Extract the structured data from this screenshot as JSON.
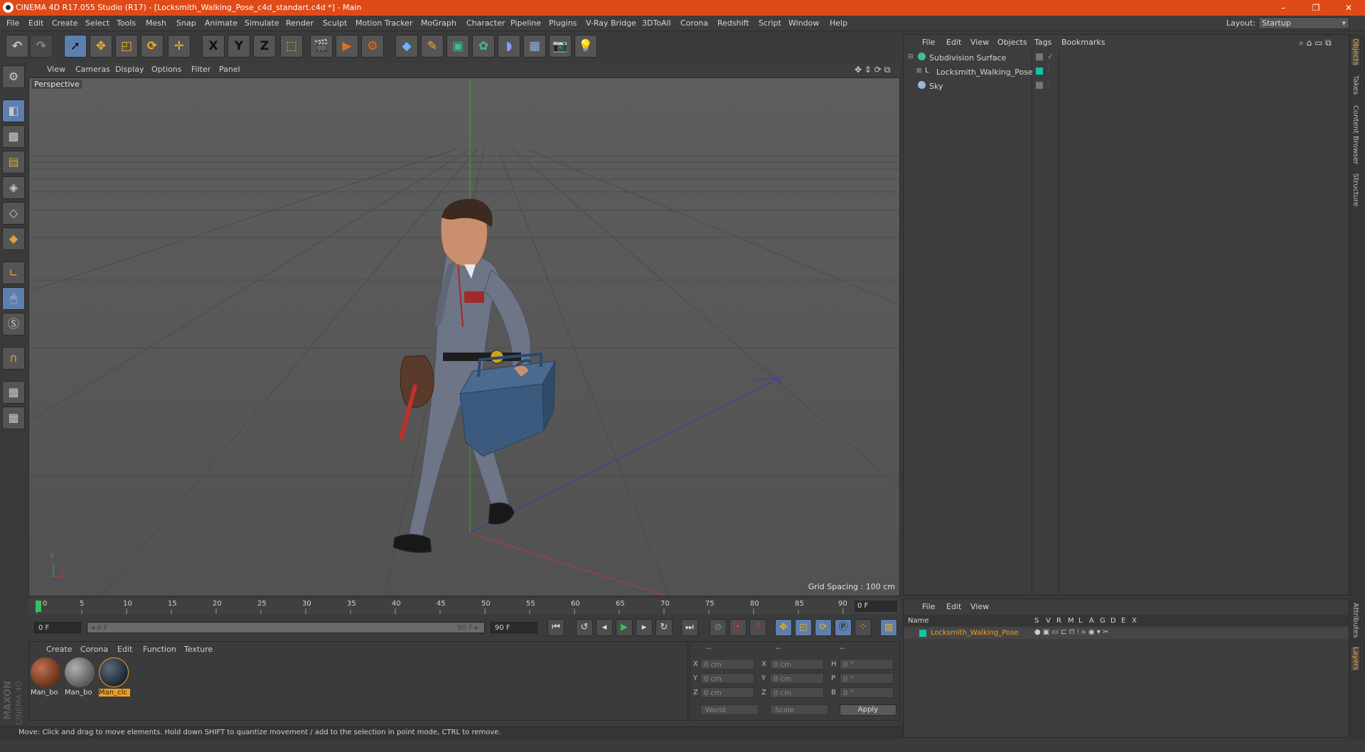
{
  "window": {
    "title": "CINEMA 4D R17.055 Studio (R17) - [Locksmith_Walking_Pose_c4d_standart.c4d *] - Main",
    "controls": [
      "–",
      "❐",
      "✕"
    ]
  },
  "menubar": {
    "items": [
      "File",
      "Edit",
      "Create",
      "Select",
      "Tools",
      "Mesh",
      "Snap",
      "Animate",
      "Simulate",
      "Render",
      "Sculpt",
      "Motion Tracker",
      "MoGraph",
      "Character",
      "Pipeline",
      "Plugins",
      "V-Ray Bridge",
      "3DToAll",
      "Corona",
      "Redshift",
      "Script",
      "Window",
      "Help"
    ],
    "layout_label": "Layout:",
    "layout_value": "Startup"
  },
  "toolbar": {
    "axis_x": "X",
    "axis_y": "Y",
    "axis_z": "Z",
    "icons": [
      "undo-icon",
      "redo-icon",
      "live-selection-icon",
      "move-icon",
      "scale-icon",
      "rotate-icon",
      "recent-tool-icon",
      "x-axis-icon",
      "y-axis-icon",
      "z-axis-icon",
      "coordinate-system-icon",
      "render-view-icon",
      "render-to-picture-viewer-icon",
      "edit-render-settings-icon",
      "cube-icon",
      "pen-spline-icon",
      "subdivision-surface-icon",
      "array-icon",
      "deformer-icon",
      "floor-icon",
      "camera-icon",
      "light-icon"
    ]
  },
  "leftbar": {
    "icons": [
      "make-editable-icon",
      "model-mode-icon",
      "texture-mode-icon",
      "workplane-icon",
      "points-mode-icon",
      "edges-mode-icon",
      "polygons-mode-icon",
      "axis-mode-icon",
      "tweak-mode-icon",
      "solo-mode-icon",
      "snap-magnet-icon",
      "lock-workplane-icon",
      "planar-workplane-icon"
    ]
  },
  "viewport": {
    "menu": [
      "View",
      "Cameras",
      "Display",
      "Options",
      "Filter",
      "Panel"
    ],
    "label": "Perspective",
    "grid_spacing": "Grid Spacing : 100 cm",
    "axis_y": "y",
    "axis_z": "z"
  },
  "timeline": {
    "ticks": [
      "0",
      "5",
      "10",
      "15",
      "20",
      "25",
      "30",
      "35",
      "40",
      "45",
      "50",
      "55",
      "60",
      "65",
      "70",
      "75",
      "80",
      "85",
      "90"
    ],
    "current_frame": "0 F"
  },
  "playback": {
    "start_field": "0 F",
    "range_start": "◂ 0 F",
    "range_end": "90 F ▸",
    "end_field": "90 F"
  },
  "material_manager": {
    "menu": [
      "Create",
      "Corona",
      "Edit",
      "Function",
      "Texture"
    ],
    "materials": [
      {
        "label": "Man_bo",
        "color": "#8a4a2a",
        "selected": false
      },
      {
        "label": "Man_bo",
        "color": "#7a7a7a",
        "selected": false
      },
      {
        "label": "Man_clc",
        "color": "#2e3a4a",
        "selected": true
      }
    ],
    "selected_color": "#f0a020"
  },
  "coordinates": {
    "header": [
      "--",
      "--",
      "--"
    ],
    "rows": [
      {
        "a": "X",
        "a_val": "0 cm",
        "b": "X",
        "b_val": "0 cm",
        "c": "H",
        "c_val": "0 °"
      },
      {
        "a": "Y",
        "a_val": "0 cm",
        "b": "Y",
        "b_val": "0 cm",
        "c": "P",
        "c_val": "0 °"
      },
      {
        "a": "Z",
        "a_val": "0 cm",
        "b": "Z",
        "b_val": "0 cm",
        "c": "B",
        "c_val": "0 °"
      }
    ],
    "mode_select": "World",
    "type_select": "Scale",
    "apply": "Apply"
  },
  "status": {
    "text": "Move: Click and drag to move elements. Hold down SHIFT to quantize movement / add to the selection in point mode, CTRL to remove."
  },
  "object_manager": {
    "menu": [
      "File",
      "Edit",
      "View",
      "Objects",
      "Tags",
      "Bookmarks"
    ],
    "objects": [
      {
        "name": "Subdivision Surface",
        "icon": "subdivision-surface-icon",
        "icon_color": "#3ec08a",
        "tag_color": ""
      },
      {
        "name": "Locksmith_Walking_Pose",
        "icon": "null-object-icon",
        "icon_color": "#d8d8d8",
        "tag_color": "#12c4a4"
      },
      {
        "name": "Sky",
        "icon": "sky-icon",
        "icon_color": "#9ab8d8",
        "tag_color": ""
      }
    ]
  },
  "layer_manager": {
    "menu": [
      "File",
      "Edit",
      "View"
    ],
    "columns": [
      "Name",
      "S",
      "V",
      "R",
      "M",
      "L",
      "A",
      "G",
      "D",
      "E",
      "X"
    ],
    "layers": [
      {
        "name": "Locksmith_Walking_Pose",
        "color": "#12c4a4"
      }
    ],
    "highlight_color": "#f0a020"
  },
  "right_tabs": [
    {
      "label": "Objects",
      "active": true
    },
    {
      "label": "Takes",
      "active": false
    },
    {
      "label": "Content Browser",
      "active": false
    },
    {
      "label": "Structure",
      "active": false
    },
    {
      "label": "Attributes",
      "active": false
    },
    {
      "label": "Layers",
      "active": true
    }
  ],
  "brand": {
    "maxon": "MAXON",
    "product": "CINEMA 4D"
  },
  "colors": {
    "titlebar": "#e04a18",
    "accent_blue": "#5d7fae",
    "viewport_bg": "#565656"
  }
}
